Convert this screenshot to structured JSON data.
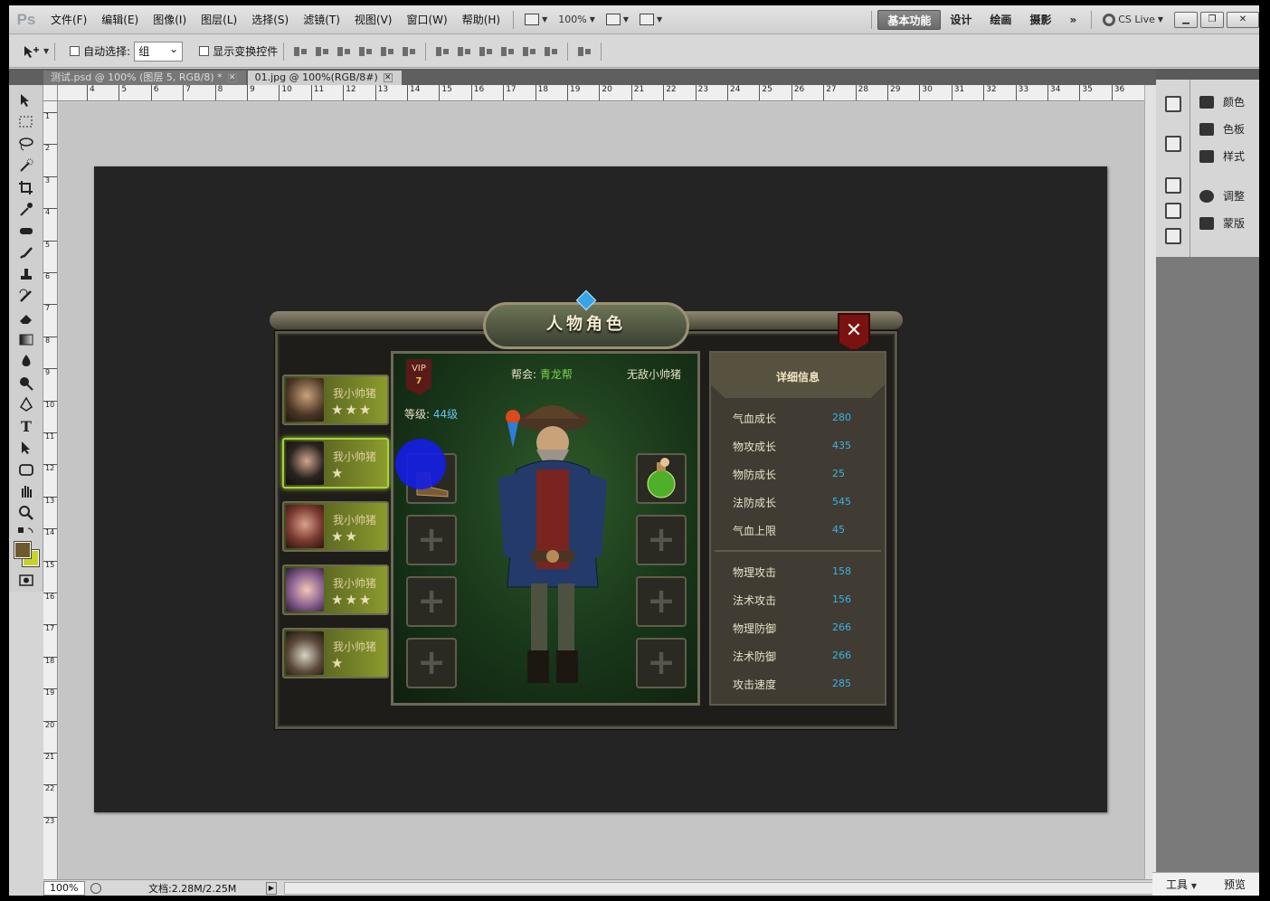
{
  "menubar": {
    "logo": "Ps",
    "items": [
      "文件(F)",
      "编辑(E)",
      "图像(I)",
      "图层(L)",
      "选择(S)",
      "滤镜(T)",
      "视图(V)",
      "窗口(W)",
      "帮助(H)"
    ],
    "zoom": "100%",
    "workspaces": [
      "基本功能",
      "设计",
      "绘画",
      "摄影"
    ],
    "more": "»",
    "cs_live": "CS Live"
  },
  "options": {
    "auto_select_label": "自动选择:",
    "auto_select_value": "组",
    "show_transform_label": "显示变换控件"
  },
  "tabs": [
    {
      "label": "测试.psd @ 100% (图层 5, RGB/8) *"
    },
    {
      "label": "01.jpg @ 100%(RGB/8#)"
    }
  ],
  "ruler": {
    "top_ticks": [
      "4",
      "5",
      "6",
      "7",
      "8",
      "9",
      "10",
      "11",
      "12",
      "13",
      "14",
      "15",
      "16",
      "17",
      "18",
      "19",
      "20",
      "21",
      "22",
      "23",
      "24",
      "25",
      "26",
      "27",
      "28",
      "29",
      "30",
      "31",
      "32",
      "33",
      "34",
      "35",
      "36"
    ],
    "left_ticks": [
      "1",
      "2",
      "3",
      "4",
      "5",
      "6",
      "7",
      "8",
      "9",
      "10",
      "11",
      "12",
      "13",
      "14",
      "15",
      "16",
      "17",
      "18",
      "19",
      "20",
      "21",
      "22",
      "23"
    ]
  },
  "status": {
    "zoom": "100%",
    "doc_info": "文档:2.28M/2.25M"
  },
  "panels": {
    "group1": [
      "颜色",
      "色板",
      "样式"
    ],
    "group2": [
      "调整",
      "蒙版"
    ],
    "bottom": [
      "工具",
      "预览"
    ]
  },
  "game": {
    "title": "人物角色",
    "close": "✕",
    "characters": [
      {
        "name": "我小帅猪",
        "stars": "★★★"
      },
      {
        "name": "我小帅猪",
        "stars": "★"
      },
      {
        "name": "我小帅猪",
        "stars": "★★"
      },
      {
        "name": "我小帅猪",
        "stars": "★★★"
      },
      {
        "name": "我小帅猪",
        "stars": "★"
      }
    ],
    "vip_label": "VIP",
    "vip_level": "7",
    "gang_label": "帮会: ",
    "gang_name": "青龙帮",
    "player_name": "无敌小帅猪",
    "level_label": "等级: ",
    "level_value": "44级",
    "detail_title": "详细信息",
    "stats_growth": [
      {
        "label": "气血成长",
        "value": "280"
      },
      {
        "label": "物攻成长",
        "value": "435"
      },
      {
        "label": "物防成长",
        "value": "25"
      },
      {
        "label": "法防成长",
        "value": "545"
      },
      {
        "label": "气血上限",
        "value": "45"
      }
    ],
    "stats_combat": [
      {
        "label": "物理攻击",
        "value": "158"
      },
      {
        "label": "法术攻击",
        "value": "156"
      },
      {
        "label": "物理防御",
        "value": "266"
      },
      {
        "label": "法术防御",
        "value": "266"
      },
      {
        "label": "攻击速度",
        "value": "285"
      }
    ]
  },
  "colors": {
    "foreground": "#6e5a2e",
    "background": "#c7d230"
  }
}
